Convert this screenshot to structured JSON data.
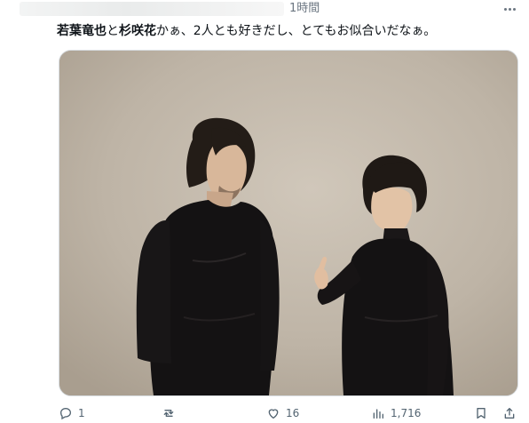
{
  "header": {
    "time": "1時間"
  },
  "tweet": {
    "name1": "若葉竜也",
    "conj": "と",
    "name2": "杉咲花",
    "rest": "かぁ、2人とも好きだし、とてもお似合いだなぁ。"
  },
  "actions": {
    "reply_count": "1",
    "like_count": "16",
    "views_count": "1,716"
  },
  "icons": [
    "more-icon",
    "reply-icon",
    "retweet-icon",
    "like-icon",
    "views-icon",
    "bookmark-icon",
    "share-icon"
  ]
}
